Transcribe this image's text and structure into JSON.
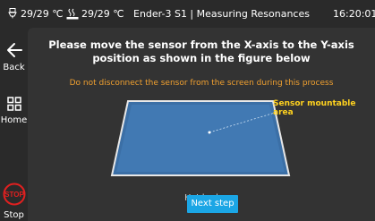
{
  "status": {
    "nozzle_temp": "29/29 ℃",
    "bed_temp": "29/29 ℃",
    "title": "Ender-3 S1 | Measuring Resonances",
    "time": "16:20:01"
  },
  "sidebar": {
    "back_label": "Back",
    "home_label": "Home",
    "stop_icon_text": "STOP",
    "stop_label": "Stop"
  },
  "main": {
    "headline_line1": "Please move the sensor from the X-axis to the Y-axis",
    "headline_line2": "position as shown in the figure below",
    "warning": "Do not disconnect the sensor from the screen during this process",
    "sensor_label_line1": "Sensor mountable",
    "sensor_label_line2": "area",
    "hotbed_label": "Hot bed",
    "next_button": "Next step"
  },
  "colors": {
    "background": "#2a2a2a",
    "panel": "#333333",
    "accent": "#1ba6e5",
    "warning": "#f0a030",
    "sensor_label": "#ffd21f",
    "stop": "#e02020"
  },
  "icons": [
    "nozzle-temperature-icon",
    "bed-temperature-icon",
    "back-arrow-icon",
    "home-grid-icon",
    "stop-icon"
  ]
}
